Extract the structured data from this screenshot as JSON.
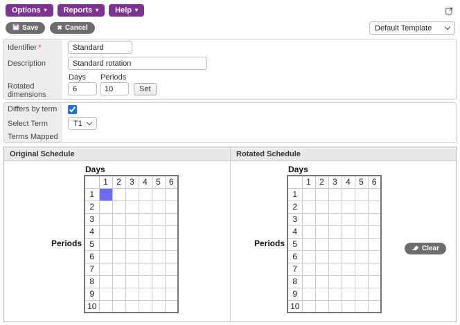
{
  "toolbar": {
    "options_label": "Options",
    "reports_label": "Reports",
    "help_label": "Help"
  },
  "actions": {
    "save_label": "Save",
    "cancel_label": "Cancel",
    "template_selected": "Default Template"
  },
  "form": {
    "identifier": {
      "label": "Identifier",
      "required_marker": "*",
      "value": "Standard"
    },
    "description": {
      "label": "Description",
      "value": "Standard rotation"
    },
    "rotated_dimensions": {
      "label": "Rotated dimensions",
      "days_label": "Days",
      "periods_label": "Periods",
      "days_value": "6",
      "periods_value": "10",
      "set_label": "Set"
    },
    "differs_by_term": {
      "label": "Differs by term",
      "checked": true
    },
    "select_term": {
      "label": "Select Term",
      "selected": "T1"
    },
    "terms_mapped": {
      "label": "Terms Mapped",
      "value": ""
    }
  },
  "schedules": {
    "days_axis_label": "Days",
    "periods_axis_label": "Periods",
    "columns": [
      "1",
      "2",
      "3",
      "4",
      "5",
      "6"
    ],
    "rows": [
      "1",
      "2",
      "3",
      "4",
      "5",
      "6",
      "7",
      "8",
      "9",
      "10"
    ],
    "panels": [
      {
        "title": "Original Schedule",
        "selected_cells": [
          {
            "row": 1,
            "col": 1
          }
        ]
      },
      {
        "title": "Rotated Schedule",
        "selected_cells": []
      }
    ],
    "clear_label": "Clear"
  },
  "icons": {
    "save": "floppy-disk",
    "cancel": "x-mark",
    "clear": "eraser",
    "top_right": "popout-window",
    "menu_caret": "caret-down",
    "select_chevron": "chevron-down"
  },
  "colors": {
    "accent_purple": "#7d3294",
    "button_gray": "#6d6d6d",
    "selected_cell": "#6e6af2",
    "checkbox_blue": "#1a73e8",
    "required_red": "#e53935"
  }
}
